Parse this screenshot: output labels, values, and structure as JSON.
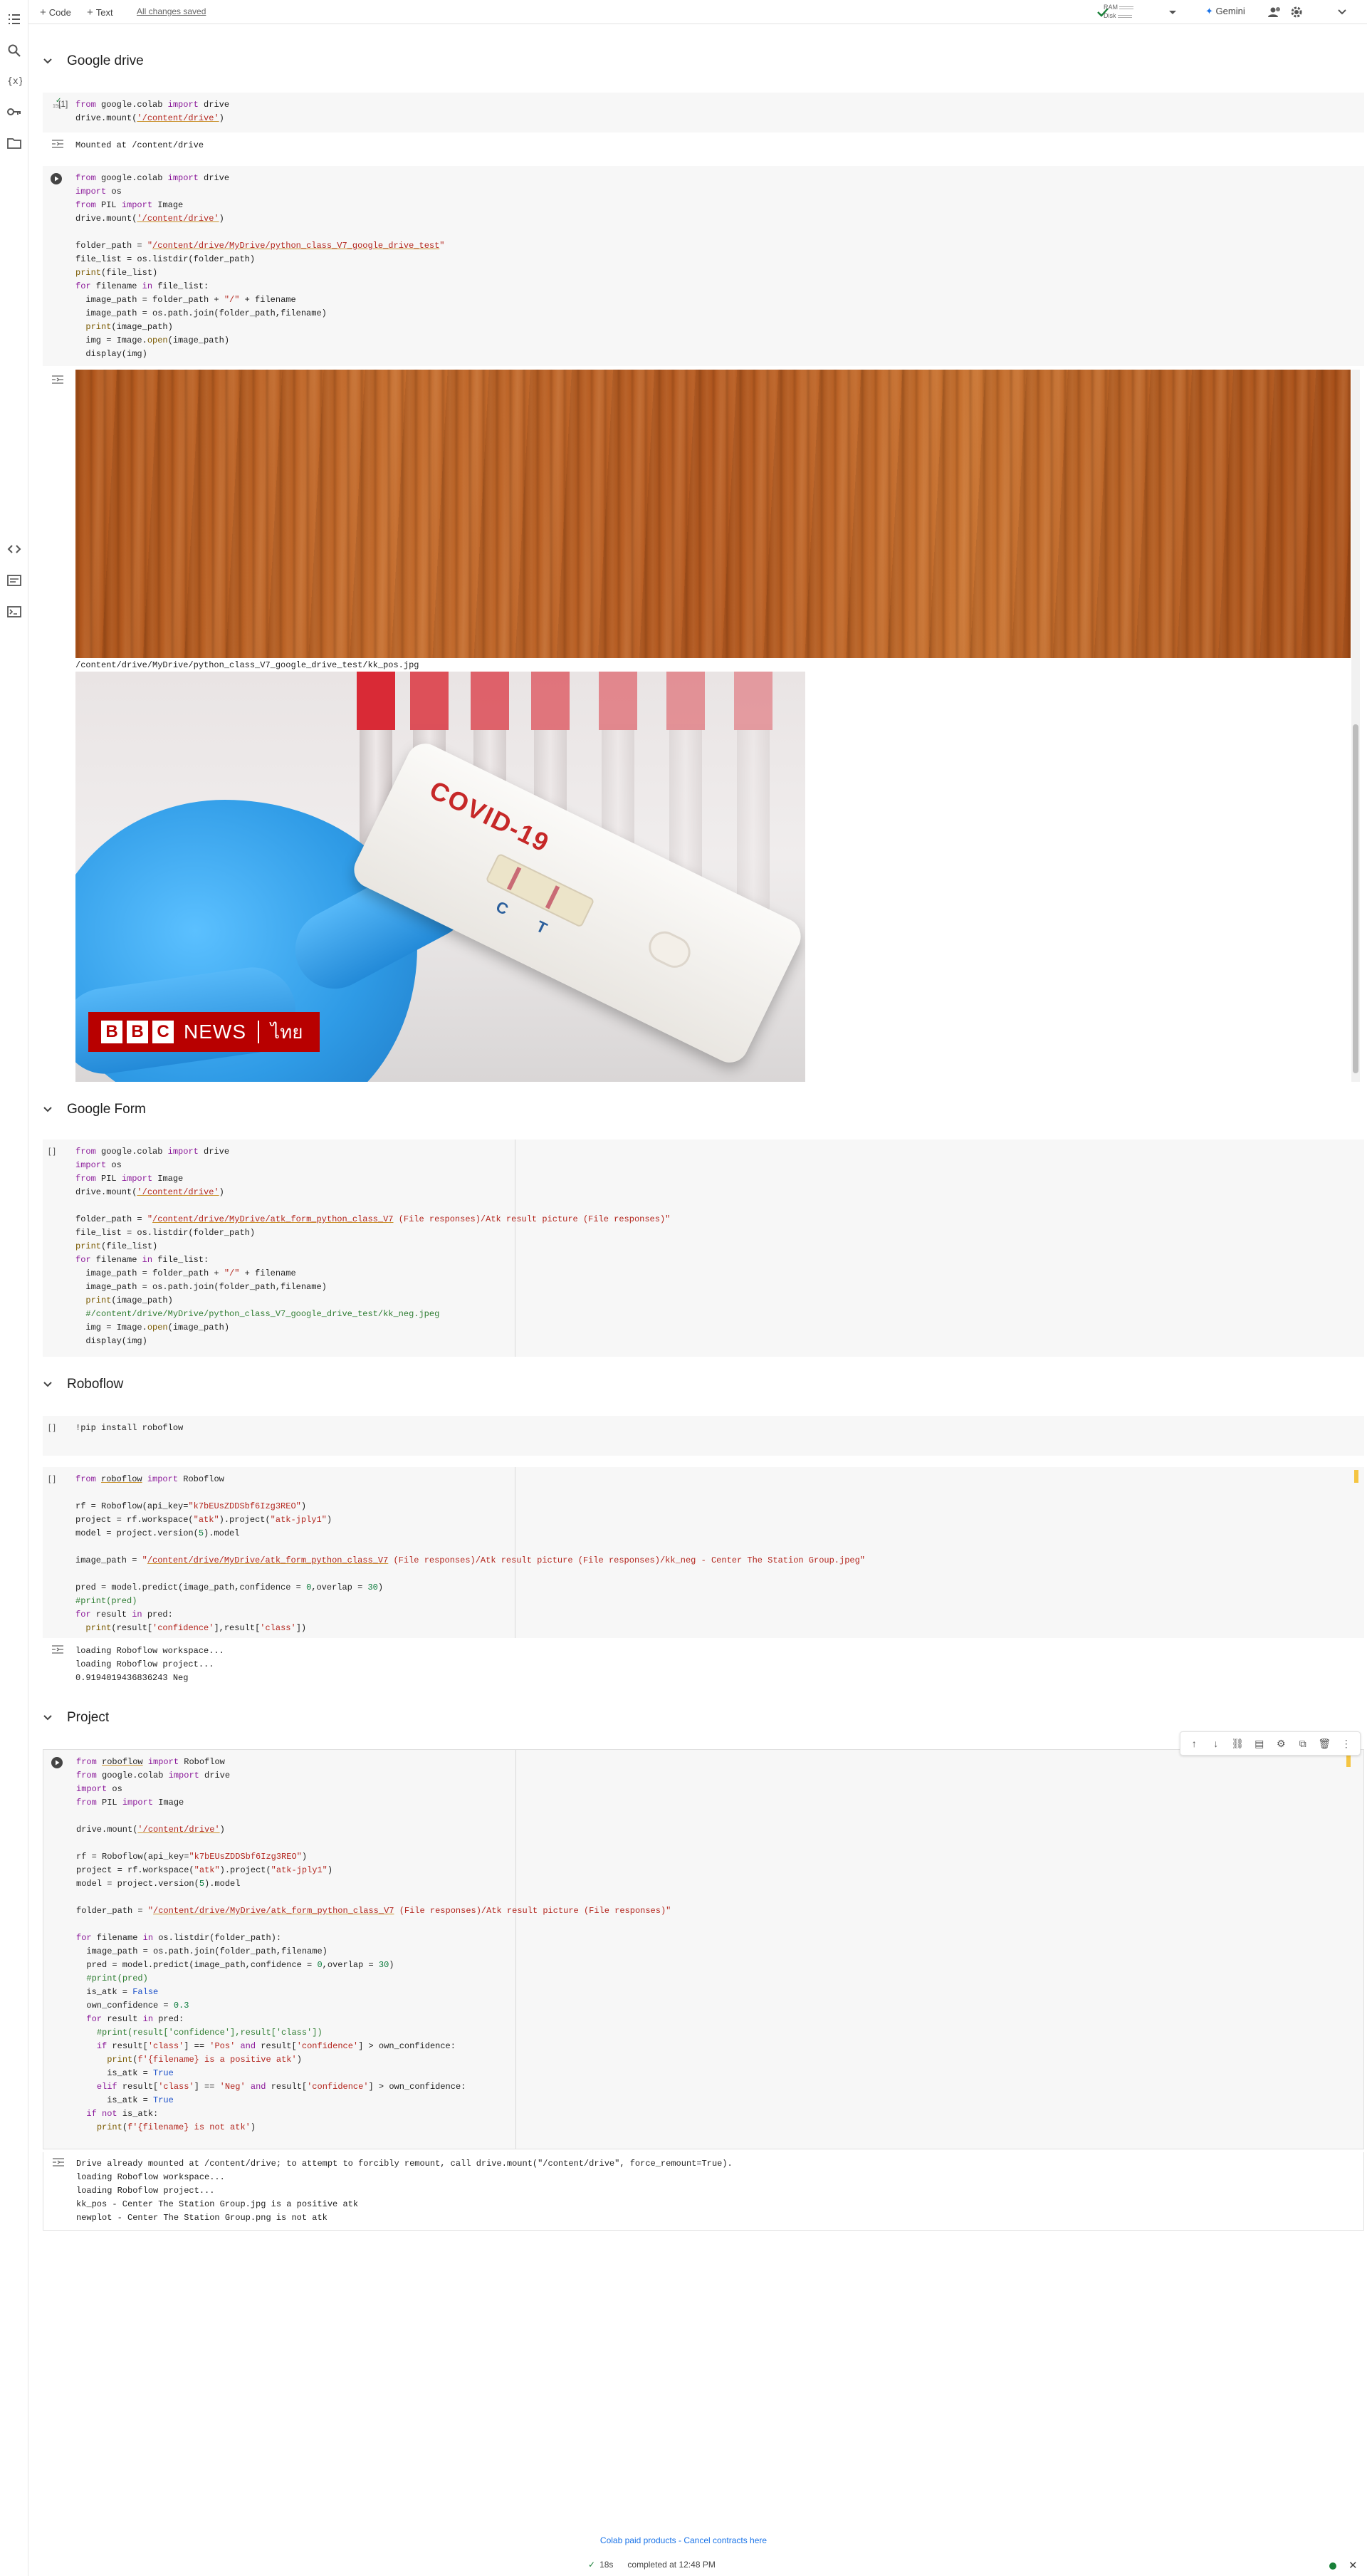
{
  "toolbar": {
    "add_code": "Code",
    "add_text": "Text",
    "saved": "All changes saved",
    "ram_label": "RAM",
    "disk_label": "Disk",
    "gemini": "Gemini"
  },
  "sections": {
    "drive": "Google drive",
    "form": "Google Form",
    "roboflow": "Roboflow",
    "project": "Project"
  },
  "cells": {
    "c1_count": "[1]",
    "c1_time": "15s",
    "c1_output": "Mounted at /content/drive",
    "c2_path_output": "/content/drive/MyDrive/python_class_V7_google_drive_test/kk_pos.jpg",
    "c3_count": "[ ]",
    "c4_count": "[ ]",
    "c5_count": "[ ]",
    "c5_output": "loading Roboflow workspace...\nloading Roboflow project...\n0.9194019436836243 Neg",
    "c6_output": "Drive already mounted at /content/drive; to attempt to forcibly remount, call drive.mount(\"/content/drive\", force_remount=True).\nloading Roboflow workspace...\nloading Roboflow project...\nkk_pos - Center The Station Group.jpg is a positive atk\nnewplot - Center The Station Group.png is not atk"
  },
  "image_text": {
    "covid": "COVID-19",
    "c_label": "C",
    "t_label": "T",
    "bbc": [
      "B",
      "B",
      "C"
    ],
    "news": "NEWS",
    "thai": "ไทย"
  },
  "footer": {
    "paid": "Colab paid products",
    "sep": " - ",
    "cancel": "Cancel contracts here",
    "status_time": "18s",
    "status_done": "completed at 12:48 PM"
  },
  "colors": {
    "accent": "#1a73e8",
    "run_ok": "#188038"
  }
}
